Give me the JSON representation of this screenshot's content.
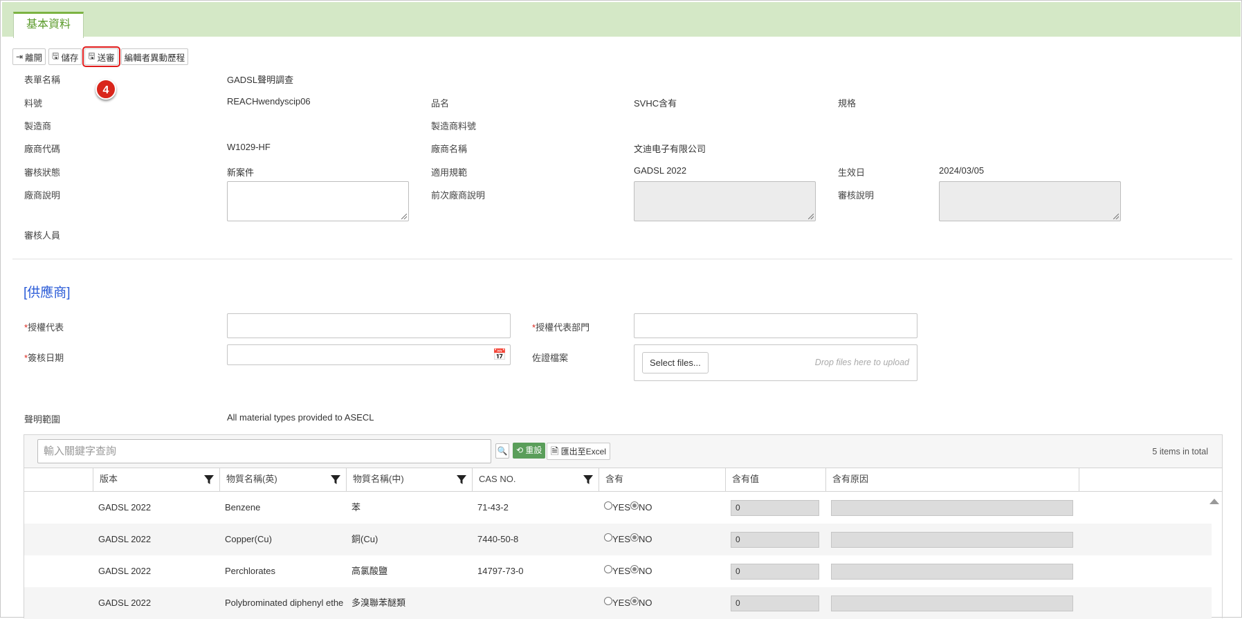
{
  "tabs": [
    {
      "label": "基本資料"
    }
  ],
  "toolbar": {
    "leave_label": "離開",
    "save_label": "儲存",
    "submit_label": "送審",
    "history_label": "編輯者異動歷程"
  },
  "annotation": {
    "step": "4"
  },
  "form": {
    "form_name_label": "表單名稱",
    "form_name_value": "GADSL聲明調查",
    "part_no_label": "料號",
    "part_no_value": "REACHwendyscip06",
    "product_name_label": "品名",
    "product_name_value": "SVHC含有",
    "spec_label": "規格",
    "spec_value": "",
    "manufacturer_label": "製造商",
    "manufacturer_value": "",
    "mfr_part_no_label": "製造商料號",
    "mfr_part_no_value": "",
    "vendor_code_label": "廠商代碼",
    "vendor_code_value": "W1029-HF",
    "vendor_name_label": "廠商名稱",
    "vendor_name_value": "文迪电子有限公司",
    "review_status_label": "審核狀態",
    "review_status_value": "新案件",
    "regulation_label": "適用規範",
    "regulation_value": "GADSL 2022",
    "effective_date_label": "生效日",
    "effective_date_value": "2024/03/05",
    "vendor_note_label": "廠商說明",
    "prev_vendor_note_label": "前次廠商說明",
    "review_note_label": "審核說明",
    "reviewer_label": "審核人員",
    "reviewer_value": ""
  },
  "supplier": {
    "section_title": "[供應商]",
    "rep_label": "授權代表",
    "rep_value": "",
    "rep_dept_label": "授權代表部門",
    "rep_dept_value": "",
    "sign_date_label": "簽核日期",
    "sign_date_value": "",
    "evidence_label": "佐證檔案",
    "select_files_label": "Select files...",
    "drop_hint": "Drop files here to upload",
    "scope_label": "聲明範圍",
    "scope_value": "All material types provided to ASECL"
  },
  "grid": {
    "search_placeholder": "輸入關鍵字查詢",
    "reset_label": "重設",
    "export_label": "匯出至Excel",
    "total_label": "5 items in total",
    "columns": [
      "版本",
      "物質名稱(英)",
      "物質名稱(中)",
      "CAS NO.",
      "含有",
      "含有值",
      "含有原因"
    ],
    "yes_label": "YES",
    "no_label": "NO",
    "rows": [
      {
        "version": "GADSL 2022",
        "name_en": "Benzene",
        "name_zh": "苯",
        "cas": "71-43-2",
        "contains": "NO",
        "value": "0",
        "reason": ""
      },
      {
        "version": "GADSL 2022",
        "name_en": "Copper(Cu)",
        "name_zh": "銅(Cu)",
        "cas": "7440-50-8",
        "contains": "NO",
        "value": "0",
        "reason": ""
      },
      {
        "version": "GADSL 2022",
        "name_en": "Perchlorates",
        "name_zh": "高氯酸鹽",
        "cas": "14797-73-0",
        "contains": "NO",
        "value": "0",
        "reason": ""
      },
      {
        "version": "GADSL 2022",
        "name_en": "Polybrominated diphenyl ethe",
        "name_zh": "多溴聯苯醚類",
        "cas": "",
        "contains": "NO",
        "value": "0",
        "reason": ""
      }
    ]
  },
  "colors": {
    "accent_green": "#7cb342",
    "tab_bg": "#d4e8c6",
    "highlight_red": "#e01b1b",
    "section_blue": "#2a5bd7"
  }
}
